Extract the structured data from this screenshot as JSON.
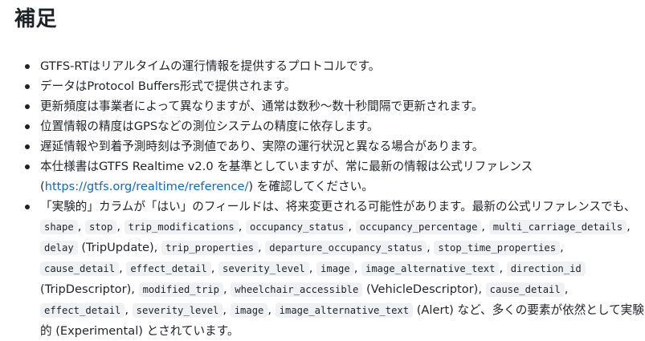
{
  "section": {
    "title": "補足"
  },
  "notes": [
    "GTFS-RTはリアルタイムの運行情報を提供するプロトコルです。",
    "データはProtocol Buffers形式で提供されます。",
    "更新頻度は事業者によって異なりますが、通常は数秒〜数十秒間隔で更新されます。",
    "位置情報の精度はGPSなどの測位システムの精度に依存します。",
    "遅延情報や到着予測時刻は予測値であり、実際の運行状況と異なる場合があります。"
  ],
  "spec_note": {
    "text_before": "本仕様書はGTFS Realtime v2.0 を基準としていますが、常に最新の情報は公式リファレンス",
    "paren_open": "(",
    "link_text": "https://gtfs.org/realtime/reference/",
    "text_after": ") を確認してください。"
  },
  "experimental_note": {
    "intro": "「実験的」カラムが「はい」のフィールドは、将来変更される可能性があります。最新の公式リファレンスでも、",
    "trip_update_fields": [
      "shape",
      "stop",
      "trip_modifications",
      "occupancy_status",
      "occupancy_percentage",
      "multi_carriage_details",
      "delay"
    ],
    "trip_update_label": "(TripUpdate),",
    "trip_descriptor_fields": [
      "trip_properties",
      "departure_occupancy_status",
      "stop_time_properties",
      "cause_detail",
      "effect_detail",
      "severity_level",
      "image",
      "image_alternative_text",
      "direction_id"
    ],
    "trip_descriptor_label": "(TripDescriptor),",
    "vehicle_descriptor_fields": [
      "modified_trip",
      "wheelchair_accessible"
    ],
    "vehicle_descriptor_label": "(VehicleDescriptor),",
    "alert_fields": [
      "cause_detail",
      "effect_detail",
      "severity_level",
      "image",
      "image_alternative_text"
    ],
    "alert_label": "(Alert)",
    "outro": "など、多くの要素が依然として実験的 (Experimental) とされています。"
  }
}
